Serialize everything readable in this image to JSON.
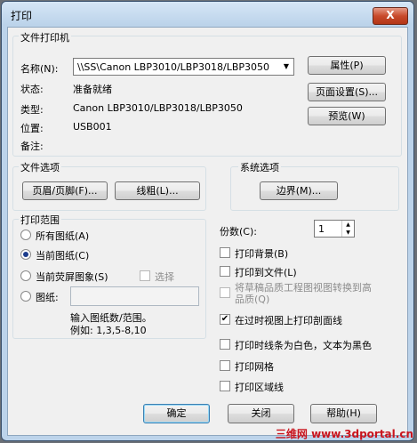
{
  "window": {
    "title": "打印",
    "close_label": "X"
  },
  "printer": {
    "group_label": "文件打印机",
    "name_label": "名称(N):",
    "name_value": "\\\\SS\\Canon LBP3010/LBP3018/LBP3050",
    "status_label": "状态:",
    "status_value": "准备就绪",
    "type_label": "类型:",
    "type_value": "Canon LBP3010/LBP3018/LBP3050",
    "location_label": "位置:",
    "location_value": "USB001",
    "comment_label": "备注:",
    "properties_button": "属性(P)",
    "page_setup_button": "页面设置(S)...",
    "preview_button": "预览(W)"
  },
  "file_options": {
    "label": "文件选项",
    "header_footer_button": "页眉/页脚(F)...",
    "linetype_button": "线粗(L)..."
  },
  "system_options": {
    "label": "系统选项",
    "border_button": "边界(M)..."
  },
  "print_range": {
    "label": "打印范围",
    "all_sheets": "所有图纸(A)",
    "current_sheet": "当前图纸(C)",
    "current_screen": "当前荧屏图象(S)",
    "select_label": "选择",
    "sheets_label": "图纸:",
    "hint_line1": "输入图纸数/范围。",
    "hint_line2": "例如: 1,3,5-8,10"
  },
  "copies": {
    "label": "份数(C):",
    "value": "1"
  },
  "options": {
    "print_background": "打印背景(B)",
    "print_to_file": "打印到文件(L)",
    "convert_quality": "将草稿品质工程图视图转换到高品质(Q)",
    "print_section_lines": "在过时视图上打印剖面线",
    "white_lines": "打印时线条为白色，文本为黑色",
    "print_grid": "打印网格",
    "print_zone_lines": "打印区域线"
  },
  "footer": {
    "ok_button": "确定",
    "close_button": "关闭",
    "help_button": "帮助(H)"
  },
  "watermark": "三维网 www.3dportal.cn"
}
